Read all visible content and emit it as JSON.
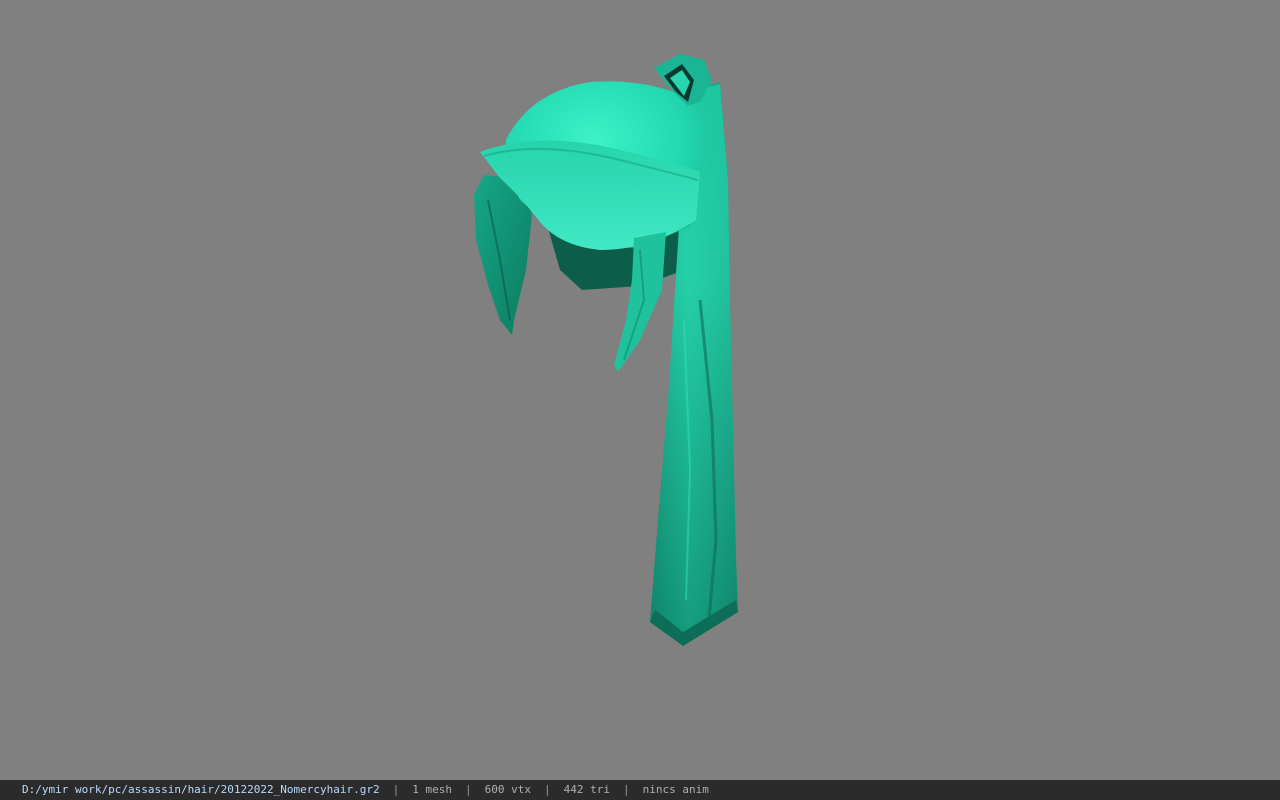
{
  "viewport": {
    "background_color": "#808080",
    "model": {
      "icon": "hair-model-icon",
      "colors": {
        "base": "#1ecfa8",
        "highlight": "#3df0c8",
        "mid": "#17b593",
        "shadow": "#0f7a62",
        "dark": "#0b5646",
        "tie": "#083a30"
      }
    }
  },
  "statusbar": {
    "file_path": "D:/ymir work/pc/assassin/hair/20122022_Nomercyhair.gr2",
    "separator": "|",
    "mesh_count": "1 mesh",
    "vertex_count": "600 vtx",
    "triangle_count": "442 tri",
    "animation": "nincs anim",
    "colors": {
      "background": "#2b2b2b",
      "path_text": "#b9d9ff",
      "stat_text": "#b0b0b0"
    }
  }
}
